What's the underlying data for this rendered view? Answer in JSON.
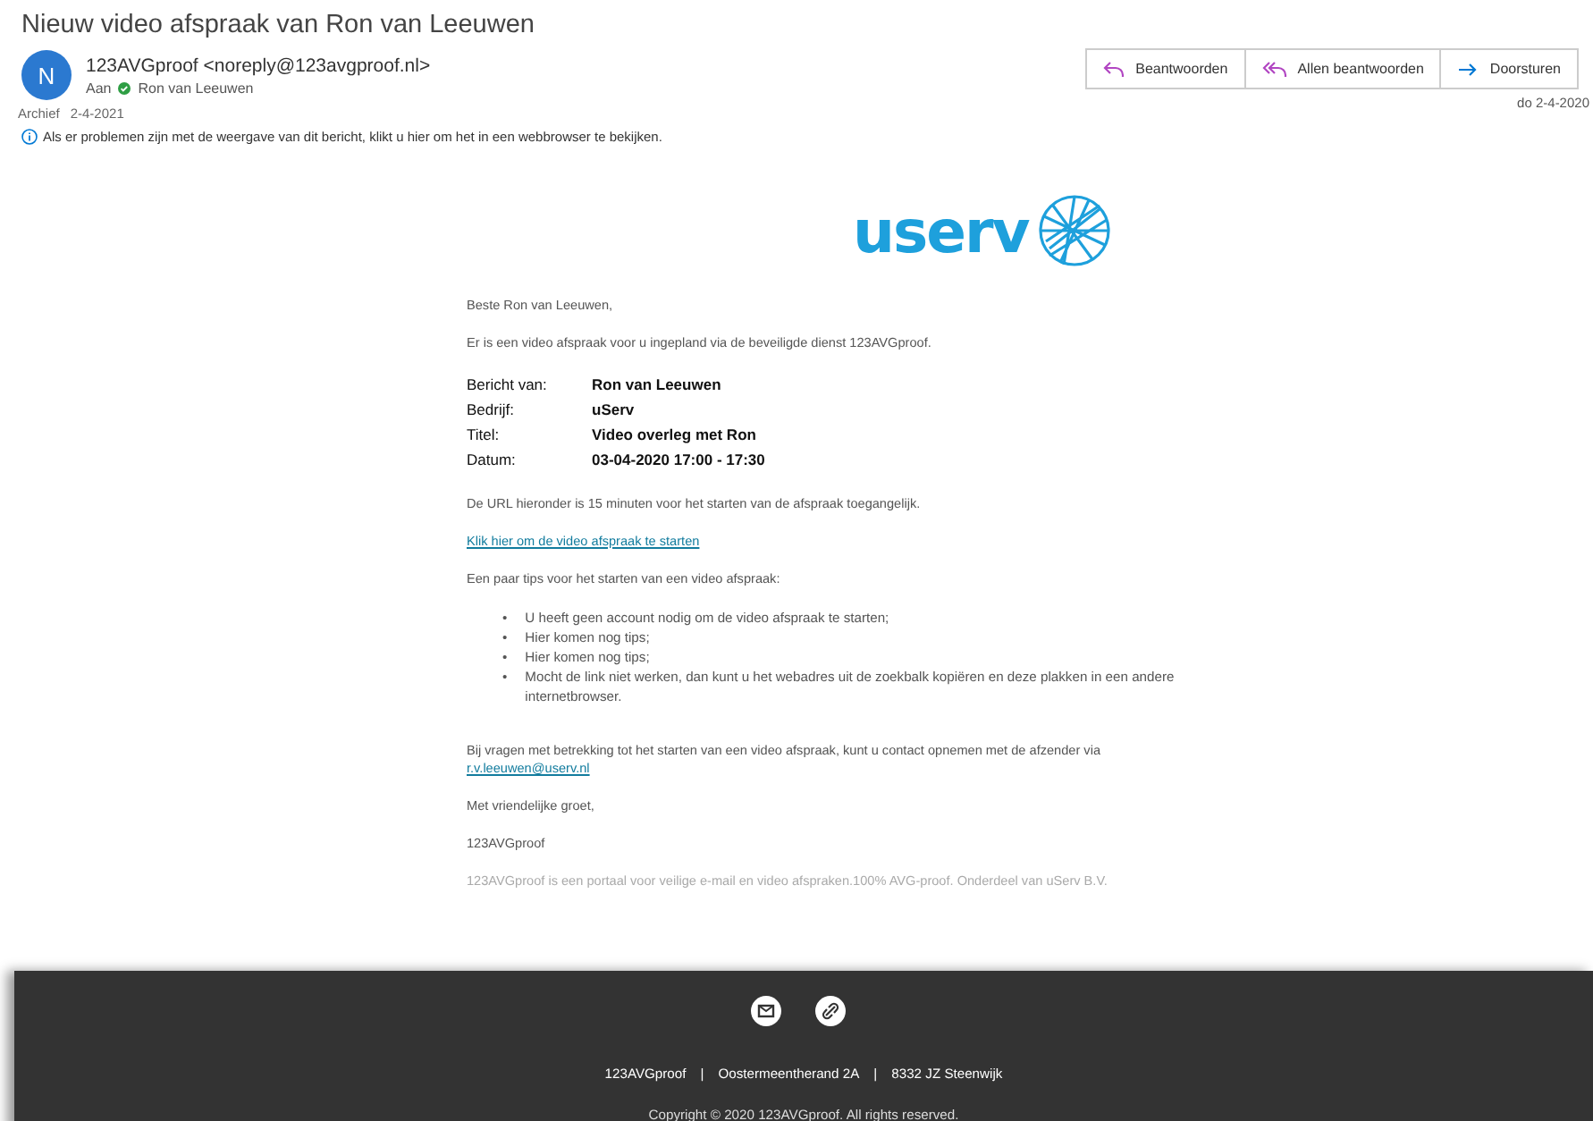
{
  "message": {
    "subject": "Nieuw video afspraak van Ron van Leeuwen",
    "avatar_letter": "N",
    "sender": "123AVGproof <noreply@123avgproof.nl>",
    "to_label": "Aan",
    "recipient": "Ron van Leeuwen",
    "folder": "Archief",
    "folder_date": "2-4-2021",
    "date": "do 2-4-2020",
    "info": "Als er problemen zijn met de weergave van dit bericht, klikt u hier om het in een webbrowser te bekijken."
  },
  "actions": [
    {
      "kind": "reply",
      "label": "Beantwoorden"
    },
    {
      "kind": "reply_all",
      "label": "Allen beantwoorden"
    },
    {
      "kind": "forward",
      "label": "Doorsturen"
    }
  ],
  "body": {
    "logo": "userv",
    "greeting": "Beste Ron van Leeuwen,",
    "intro": "Er is een video afspraak voor u ingepland via de beveiligde dienst 123AVGproof.",
    "details": [
      {
        "label": "Bericht van:",
        "value": "Ron van Leeuwen"
      },
      {
        "label": "Bedrijf:",
        "value": "uServ"
      },
      {
        "label": "Titel:",
        "value": "Video overleg met Ron"
      },
      {
        "label": "Datum:",
        "value": "03-04-2020 17:00 - 17:30"
      }
    ],
    "url_note": "De URL hieronder is 15 minuten voor het starten van de afspraak toegangelijk.",
    "start_link": "Klik hier om de video afspraak te starten",
    "tips_intro": "Een paar tips voor het starten van een video afspraak:",
    "bullet": "•",
    "tips": [
      "U heeft geen account nodig om de video afspraak te starten;",
      "Hier komen nog tips;",
      "Hier komen nog tips;",
      "Mocht de link niet werken, dan kunt u het webadres uit de zoekbalk kopiëren en deze plakken in een andere internetbrowser."
    ],
    "contact": "Bij vragen met betrekking tot het starten van een video afspraak, kunt u contact opnemen met de afzender via",
    "contact_email": "r.v.leeuwen@userv.nl",
    "closing": "Met vriendelijke groet,",
    "signature": "123AVGproof",
    "disclaimer": "123AVGproof is een portaal voor veilige e-mail en video afspraken.100% AVG-proof. Onderdeel van uServ B.V."
  },
  "footer": {
    "address": [
      "123AVGproof",
      "Oostermeentherand 2A",
      "8332 JZ Steenwijk"
    ],
    "separator": "|",
    "copyright": "Copyright © 2020 123AVGproof. All rights reserved."
  }
}
